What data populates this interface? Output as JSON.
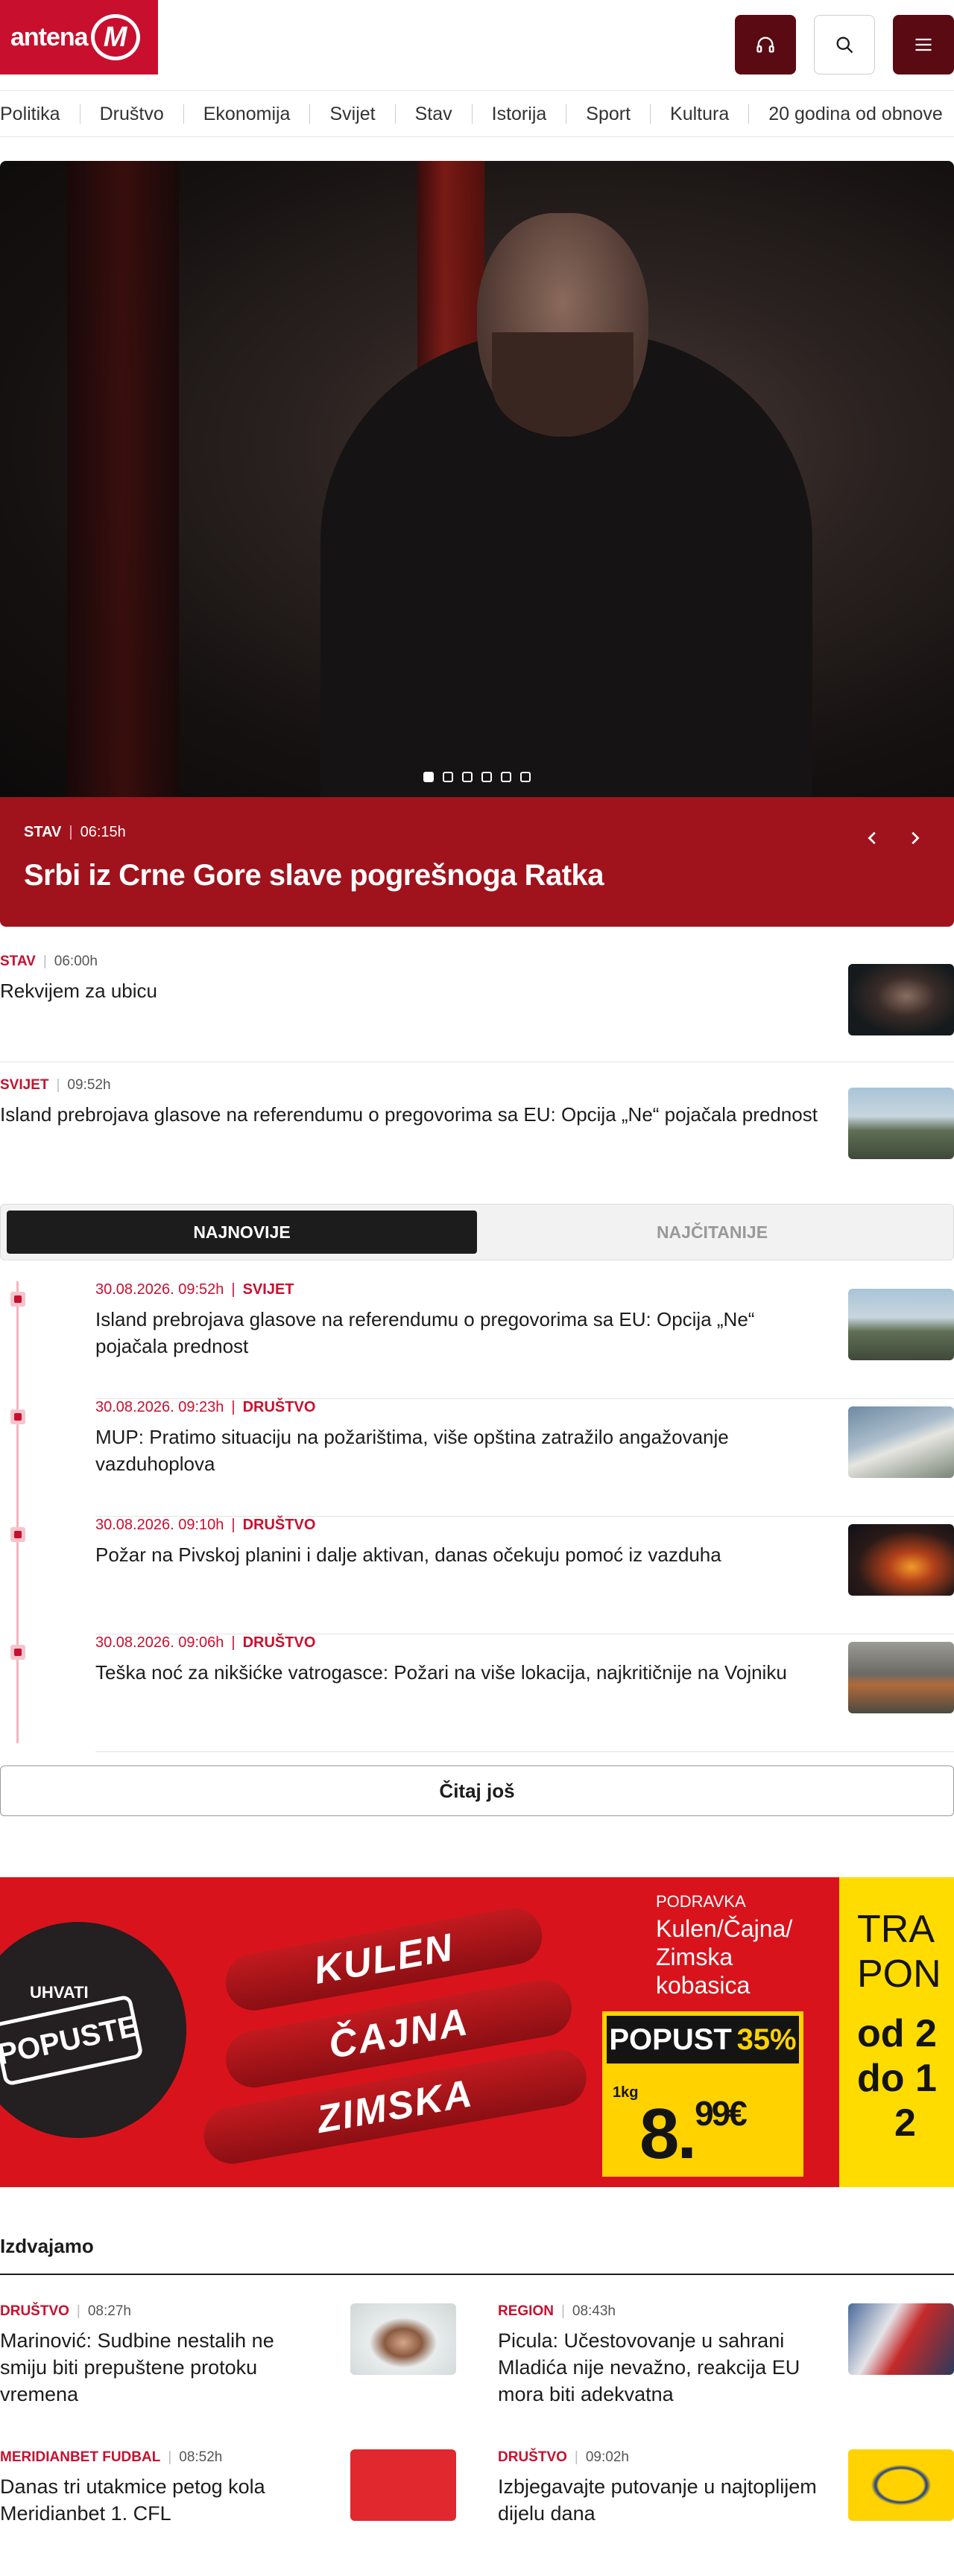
{
  "header": {
    "logo_text": "antena",
    "logo_letter": "M",
    "icons": [
      "headphones-icon",
      "search-icon",
      "menu-icon"
    ]
  },
  "nav": [
    "Politika",
    "Društvo",
    "Ekonomija",
    "Svijet",
    "Stav",
    "Istorija",
    "Sport",
    "Kultura",
    "20 godina od obnove"
  ],
  "hero": {
    "category": "STAV",
    "time": "06:15h",
    "title": "Srbi iz Crne Gore slave pogrešnoga Ratka",
    "slides": 6,
    "active_slide": 1
  },
  "top_list": [
    {
      "category": "STAV",
      "time": "06:00h",
      "title": "Rekvijem za ubicu"
    },
    {
      "category": "SVIJET",
      "time": "09:52h",
      "title": "Island prebrojava glasove na referendumu o pregovorima sa EU: Opcija „Ne“ pojačala prednost"
    }
  ],
  "tabs": {
    "active": "NAJNOVIJE",
    "inactive": "NAJČITANIJE"
  },
  "latest": [
    {
      "datetime": "30.08.2026. 09:52h",
      "category": "SVIJET",
      "title": "Island prebrojava glasove na referendumu o pregovorima sa EU: Opcija „Ne“ pojačala prednost"
    },
    {
      "datetime": "30.08.2026. 09:23h",
      "category": "DRUŠTVO",
      "title": "MUP: Pratimo situaciju na požarištima, više opština zatražilo angažovanje vazduhoplova"
    },
    {
      "datetime": "30.08.2026. 09:10h",
      "category": "DRUŠTVO",
      "title": "Požar na Pivskoj planini i dalje aktivan, danas očekuju pomoć iz vazduha"
    },
    {
      "datetime": "30.08.2026. 09:06h",
      "category": "DRUŠTVO",
      "title": "Teška noć za nikšićke vatrogasce: Požari na više lokacija, najkritičnije na Vojniku"
    }
  ],
  "more_label": "Čitaj još",
  "banner": {
    "uhvati": "UHVATI",
    "popuste": "POPUSTE",
    "products": [
      "KULEN",
      "ČAJNA",
      "ZIMSKA"
    ],
    "brand": "PODRAVKA",
    "name": "Kulen/Čajna/ Zimska kobasica",
    "discount_word": "POPUST",
    "discount_value": "35%",
    "unit": "1kg",
    "price_main": "8.",
    "price_cents": "99€",
    "side_lines": [
      "TRA",
      "PON",
      "od 2",
      "do 1",
      "2"
    ]
  },
  "featured": {
    "title": "Izdvajamo",
    "items": [
      {
        "category": "DRUŠTVO",
        "time": "08:27h",
        "title": "Marinović: Sudbine nestalih ne smiju biti prepuštene protoku vremena"
      },
      {
        "category": "REGION",
        "time": "08:43h",
        "title": "Picula: Učestovovanje u sahrani Mladića nije nevažno, reakcija EU mora biti adekvatna"
      },
      {
        "category": "MERIDIANBET FUDBAL",
        "time": "08:52h",
        "title": "Danas tri utakmice petog kola Meridianbet 1. CFL"
      },
      {
        "category": "DRUŠTVO",
        "time": "09:02h",
        "title": "Izbjegavajte putovanje u najtoplijem dijelu dana"
      }
    ]
  },
  "colors": {
    "brand_red": "#c8102e",
    "dark_red": "#5a0a12",
    "hero_bar": "#a0131c",
    "banner_yellow": "#ffd200"
  }
}
